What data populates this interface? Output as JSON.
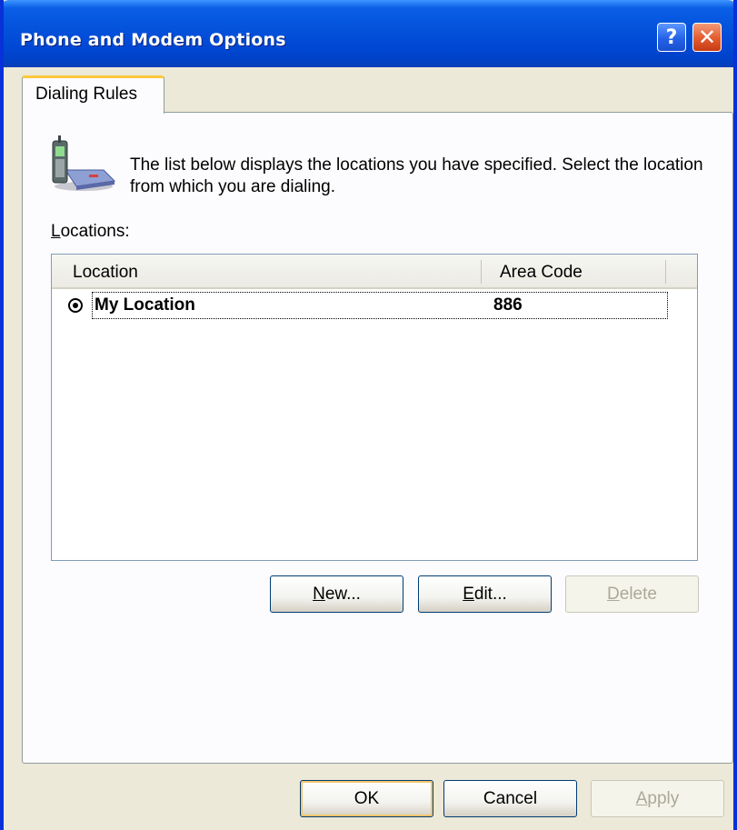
{
  "window": {
    "title": "Phone and Modem Options"
  },
  "titlebar_buttons": {
    "help": "?",
    "close": "✕"
  },
  "tabs": [
    {
      "label": "Dialing Rules",
      "active": true
    }
  ],
  "description": "The list below displays the locations you have specified. Select the location from which you are dialing.",
  "locations": {
    "label_mnemonic": "L",
    "label_rest": "ocations:",
    "columns": [
      "Location",
      "Area Code"
    ],
    "rows": [
      {
        "name": "My Location",
        "area_code": "886",
        "selected": true
      }
    ]
  },
  "list_buttons": {
    "new": {
      "mnemonic": "N",
      "rest": "ew..."
    },
    "edit": {
      "mnemonic": "E",
      "rest": "dit..."
    },
    "delete": {
      "mnemonic": "D",
      "rest": "elete",
      "disabled": true
    }
  },
  "dialog_buttons": {
    "ok": "OK",
    "cancel": "Cancel",
    "apply": {
      "mnemonic": "A",
      "rest": "pply",
      "disabled": true
    }
  },
  "colors": {
    "titlebar": "#0553dc",
    "face": "#ece9d8",
    "tab_highlight": "#ffc83c",
    "border_blue": "#0831d9"
  }
}
